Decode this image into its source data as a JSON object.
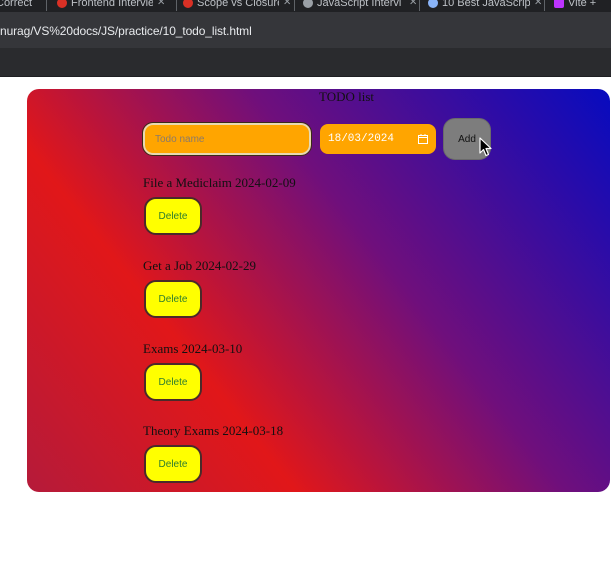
{
  "browser": {
    "tabs": [
      {
        "title": "Correct",
        "favicon_color": "#5f6368"
      },
      {
        "title": "Frontend Intervie",
        "favicon_color": "#d93025"
      },
      {
        "title": "Scope vs Closure",
        "favicon_color": "#d93025"
      },
      {
        "title": "JavaScript Intervi",
        "favicon_color": "#9aa0a6"
      },
      {
        "title": "10 Best JavaScrip",
        "favicon_color": "#8ab4f8"
      },
      {
        "title": "Vite +",
        "favicon_color": "#bd34fe"
      }
    ],
    "url": "nurag/VS%20docs/JS/practice/10_todo_list.html"
  },
  "app": {
    "title": "TODO list",
    "name_input": {
      "value": "",
      "placeholder": "Todo name"
    },
    "date_input": {
      "value": "18/03/2024"
    },
    "add_label": "Add",
    "todos": [
      {
        "text": "File a Mediclaim 2024-02-09",
        "delete_label": "Delete"
      },
      {
        "text": "Get a Job 2024-02-29",
        "delete_label": "Delete"
      },
      {
        "text": "Exams 2024-03-10",
        "delete_label": "Delete"
      },
      {
        "text": "Theory Exams 2024-03-18",
        "delete_label": "Delete"
      }
    ]
  },
  "colors": {
    "card_gradient": [
      "#b51a3a",
      "#e11719",
      "#6f0f7c",
      "#070bbf"
    ],
    "input_bg": "#ffa500",
    "add_button_bg": "#7d7d7d",
    "delete_button_bg": "#ffff00"
  }
}
